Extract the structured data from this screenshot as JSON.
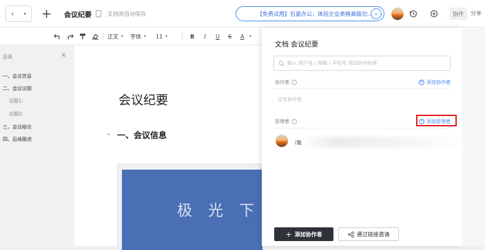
{
  "topbar": {
    "back_glyph": "‹",
    "dropdown_glyph": "▾",
    "new_glyph": "+",
    "doc_title": "会议纪要",
    "save_status": "文档将自动保存",
    "promo_text": "【免费试用】石墨办公，体验企业表格高级功...",
    "promo_arrow": "»",
    "collab_label": "协作",
    "share_label": "分享"
  },
  "toolbar": {
    "style_label": "正文",
    "font_label": "字体",
    "size_label": "11",
    "bold": "B",
    "italic": "I",
    "underline": "U",
    "strike": "S",
    "color": "A"
  },
  "sidebar": {
    "title": "目录",
    "close": "×",
    "items": [
      {
        "label": "一、会议信息",
        "level": 1
      },
      {
        "label": "二、会议议题",
        "level": 1
      },
      {
        "label": "议题1:",
        "level": 2
      },
      {
        "label": "议题2:",
        "level": 2
      },
      {
        "label": "三、会议结论",
        "level": 1
      },
      {
        "label": "四、后续跟进",
        "level": 1
      }
    ]
  },
  "document": {
    "title": "会议纪要",
    "section_heading": "一、会议信息",
    "image_text": "极 光 下"
  },
  "panel": {
    "title": "文档 会议纪要",
    "search_placeholder": "输入 用户名 / 邮箱 / 手机号 添加协作权限",
    "collaborators_label": "协作者",
    "add_collaborator_link": "添加协作者",
    "empty_collaborators": "没有协作者",
    "managers_label": "管理者",
    "add_manager_link": "添加管理者",
    "member_name": "(我",
    "btn_add_collab": "添加协作者",
    "btn_add_collab_glyph": "+",
    "btn_link_invite": "通过链接邀请"
  },
  "colors": {
    "accent": "#4a8cf0",
    "highlight": "#e02020",
    "dark_button": "#2f3238"
  }
}
